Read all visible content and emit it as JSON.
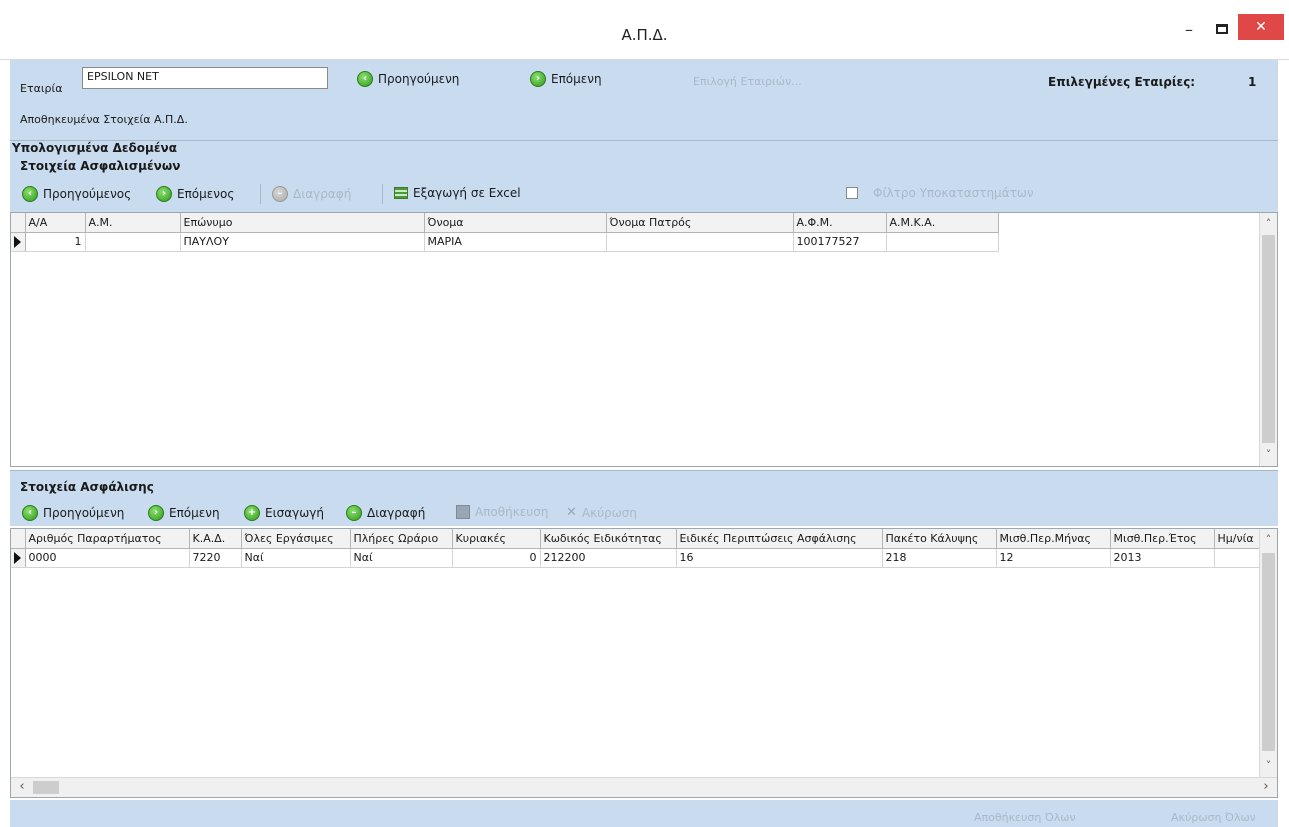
{
  "window": {
    "title": "Α.Π.Δ.",
    "minimize_glyph": "–",
    "close_glyph": "✕"
  },
  "company": {
    "label": "Εταιρία",
    "value": "EPSILON NET",
    "prev_label": "Προηγούμενη",
    "next_label": "Επόμενη",
    "select_label": "Επιλογή Εταιριών...",
    "selected_label": "Επιλεγμένες Εταιρίες:",
    "selected_count": "1",
    "saved_label": "Αποθηκευμένα Στοιχεία Α.Π.Δ."
  },
  "calculated": {
    "heading": "Υπολογισμένα Δεδομένα"
  },
  "insured": {
    "heading": "Στοιχεία Ασφαλισμένων",
    "toolbar": {
      "prev": "Προηγούμενος",
      "next": "Επόμενος",
      "delete": "Διαγραφή",
      "export": "Εξαγωγή σε Excel",
      "branch_filter": "Φίλτρο Υποκαταστημάτων"
    },
    "columns": [
      "Α/Α",
      "Α.Μ.",
      "Επώνυμο",
      "Όνομα",
      "Όνομα Πατρός",
      "Α.Φ.Μ.",
      "Α.Μ.Κ.Α."
    ],
    "rows": [
      [
        "1",
        "",
        "ΠΑΥΛΟΥ",
        "ΜΑΡΙΑ",
        "",
        "100177527",
        ""
      ]
    ]
  },
  "insurance": {
    "heading": "Στοιχεία Ασφάλισης",
    "toolbar": {
      "prev": "Προηγούμενη",
      "next": "Επόμενη",
      "insert": "Εισαγωγή",
      "delete": "Διαγραφή",
      "save": "Αποθήκευση",
      "cancel": "Ακύρωση"
    },
    "columns": [
      "Αριθμός Παραρτήματος",
      "Κ.Α.Δ.",
      "Όλες Εργάσιμες",
      "Πλήρες Ωράριο",
      "Κυριακές",
      "Κωδικός Ειδικότητας",
      "Ειδικές Περιπτώσεις Ασφάλισης",
      "Πακέτο Κάλυψης",
      "Μισθ.Περ.Μήνας",
      "Μισθ.Περ.Έτος",
      "Ημ/νία"
    ],
    "rows": [
      [
        "0000",
        "7220",
        "Ναί",
        "Ναί",
        "0",
        "212200",
        "16",
        "218",
        "12",
        "2013",
        ""
      ]
    ]
  },
  "footer": {
    "save_all": "Αποθήκευση Όλων",
    "cancel_all": "Ακύρωση Όλων"
  }
}
